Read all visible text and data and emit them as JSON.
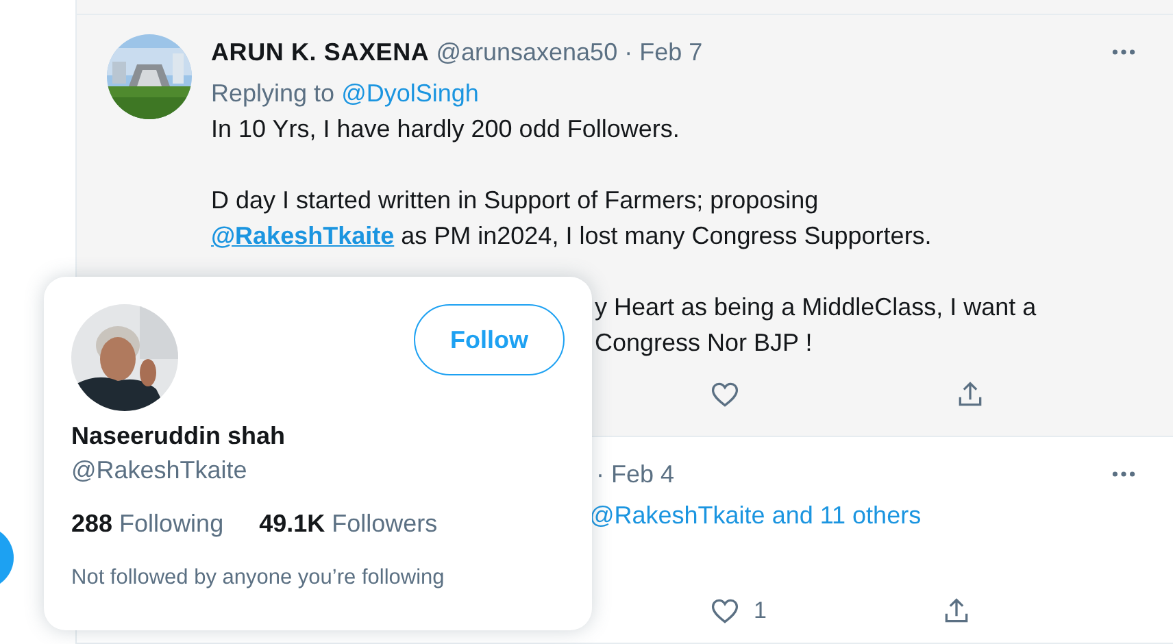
{
  "tweet": {
    "name": "ARUN K. SAXENA",
    "handle": "@arunsaxena50",
    "separator": "·",
    "date": "Feb 7",
    "replying_prefix": "Replying to",
    "reply_to": "@DyolSingh",
    "line_1": "In 10 Yrs, I have hardly 200 odd Followers.",
    "paragraph_2_start": "D day I started written in Support of Farmers; proposing",
    "mention": "@RakeshTkaite",
    "paragraph_2_end": "as PM in2024, I lost many Congress Supporters.",
    "covered_lines": [
      "y Heart as being a MiddleClass, I want a",
      "Congress Nor BJP !"
    ]
  },
  "next_tweet": {
    "separator": "·",
    "date": "Feb 4",
    "replying_fragment": "@RakeshTkaite and 11 others",
    "like_count": "1"
  },
  "hover_card": {
    "name": "Naseeruddin shah",
    "handle": "@RakeshTkaite",
    "follow_button": "Follow",
    "following_count": "288",
    "following_label": "Following",
    "followers_count": "49.1K",
    "followers_label": "Followers",
    "note": "Not followed by anyone you’re following"
  }
}
